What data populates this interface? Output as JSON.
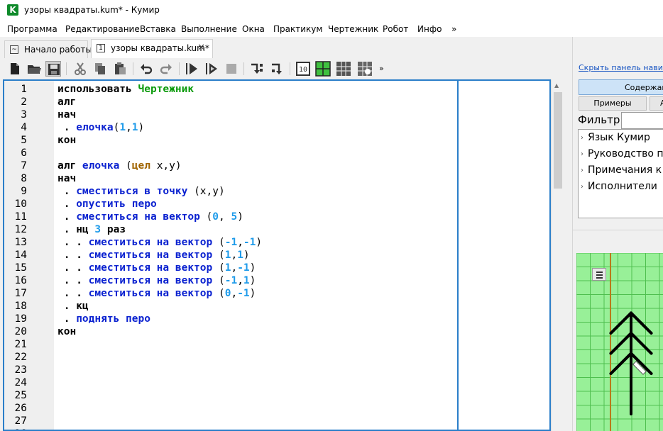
{
  "window": {
    "title": "узоры квадраты.kum* - Кумир",
    "app_icon_letter": "K"
  },
  "menu": [
    "Программа",
    "Редактирование",
    "Вставка",
    "Выполнение",
    "Окна",
    "Практикум",
    "Чертежник",
    "Робот",
    "Инфо",
    "»"
  ],
  "tabs": [
    {
      "label": "Начало работы",
      "icon": "chart-icon"
    },
    {
      "label": "узоры квадраты.kum*",
      "icon": "document-1-icon",
      "active": true
    }
  ],
  "toolbar": {
    "more": "»",
    "icons": [
      "new-file-icon",
      "open-folder-icon",
      "save-icon",
      "cut-icon",
      "copy-icon",
      "paste-icon",
      "undo-icon",
      "redo-icon",
      "run-icon",
      "step-run-icon",
      "stop-icon",
      "step-into-icon",
      "step-out-icon",
      "robot-number-icon",
      "drawer-grid-icon",
      "robot-grid-icon",
      "robot-panel-icon"
    ]
  },
  "editor": {
    "line_count": 28,
    "lines": [
      [
        {
          "t": "использовать ",
          "c": "kw"
        },
        {
          "t": "Чертежник",
          "c": "exe"
        }
      ],
      [
        {
          "t": "алг",
          "c": "kw"
        }
      ],
      [
        {
          "t": "нач",
          "c": "kw"
        }
      ],
      [
        {
          "t": " . ",
          "c": "dot"
        },
        {
          "t": "елочка",
          "c": "act"
        },
        {
          "t": "(",
          "c": "plain"
        },
        {
          "t": "1",
          "c": "num"
        },
        {
          "t": ",",
          "c": "plain"
        },
        {
          "t": "1",
          "c": "num"
        },
        {
          "t": ")",
          "c": "plain"
        }
      ],
      [
        {
          "t": "кон",
          "c": "kw"
        }
      ],
      [],
      [
        {
          "t": "алг ",
          "c": "kw"
        },
        {
          "t": "елочка ",
          "c": "act"
        },
        {
          "t": "(",
          "c": "plain"
        },
        {
          "t": "цел ",
          "c": "type"
        },
        {
          "t": "x,y)",
          "c": "plain"
        }
      ],
      [
        {
          "t": "нач",
          "c": "kw"
        }
      ],
      [
        {
          "t": " . ",
          "c": "dot"
        },
        {
          "t": "сместиться в точку ",
          "c": "act"
        },
        {
          "t": "(x,y)",
          "c": "plain"
        }
      ],
      [
        {
          "t": " . ",
          "c": "dot"
        },
        {
          "t": "опустить перо",
          "c": "act"
        }
      ],
      [
        {
          "t": " . ",
          "c": "dot"
        },
        {
          "t": "сместиться на вектор ",
          "c": "act"
        },
        {
          "t": "(",
          "c": "plain"
        },
        {
          "t": "0",
          "c": "num"
        },
        {
          "t": ", ",
          "c": "plain"
        },
        {
          "t": "5",
          "c": "num"
        },
        {
          "t": ")",
          "c": "plain"
        }
      ],
      [
        {
          "t": " . ",
          "c": "dot"
        },
        {
          "t": "нц ",
          "c": "kw"
        },
        {
          "t": "3",
          "c": "num"
        },
        {
          "t": " раз",
          "c": "kw"
        }
      ],
      [
        {
          "t": " . . ",
          "c": "dot"
        },
        {
          "t": "сместиться на вектор ",
          "c": "act"
        },
        {
          "t": "(",
          "c": "plain"
        },
        {
          "t": "-1",
          "c": "num"
        },
        {
          "t": ",",
          "c": "plain"
        },
        {
          "t": "-1",
          "c": "num"
        },
        {
          "t": ")",
          "c": "plain"
        }
      ],
      [
        {
          "t": " . . ",
          "c": "dot"
        },
        {
          "t": "сместиться на вектор ",
          "c": "act"
        },
        {
          "t": "(",
          "c": "plain"
        },
        {
          "t": "1",
          "c": "num"
        },
        {
          "t": ",",
          "c": "plain"
        },
        {
          "t": "1",
          "c": "num"
        },
        {
          "t": ")",
          "c": "plain"
        }
      ],
      [
        {
          "t": " . . ",
          "c": "dot"
        },
        {
          "t": "сместиться на вектор ",
          "c": "act"
        },
        {
          "t": "(",
          "c": "plain"
        },
        {
          "t": "1",
          "c": "num"
        },
        {
          "t": ",",
          "c": "plain"
        },
        {
          "t": "-1",
          "c": "num"
        },
        {
          "t": ")",
          "c": "plain"
        }
      ],
      [
        {
          "t": " . . ",
          "c": "dot"
        },
        {
          "t": "сместиться на вектор ",
          "c": "act"
        },
        {
          "t": "(",
          "c": "plain"
        },
        {
          "t": "-1",
          "c": "num"
        },
        {
          "t": ",",
          "c": "plain"
        },
        {
          "t": "1",
          "c": "num"
        },
        {
          "t": ")",
          "c": "plain"
        }
      ],
      [
        {
          "t": " . . ",
          "c": "dot"
        },
        {
          "t": "сместиться на вектор ",
          "c": "act"
        },
        {
          "t": "(",
          "c": "plain"
        },
        {
          "t": "0",
          "c": "num"
        },
        {
          "t": ",",
          "c": "plain"
        },
        {
          "t": "-1",
          "c": "num"
        },
        {
          "t": ")",
          "c": "plain"
        }
      ],
      [
        {
          "t": " . ",
          "c": "dot"
        },
        {
          "t": "кц",
          "c": "kw"
        }
      ],
      [
        {
          "t": " . ",
          "c": "dot"
        },
        {
          "t": "поднять перо",
          "c": "act"
        }
      ],
      [
        {
          "t": "кон",
          "c": "kw"
        }
      ]
    ]
  },
  "help_panel": {
    "hide_link": "Скрыть панель навигац",
    "contents_button": "Содержан",
    "examples_button": "Примеры",
    "second_button": "А",
    "filter_label": "Фильтр:",
    "filter_value": "",
    "tree_items": [
      "Язык Кумир",
      "Руководство по",
      "Примечания к",
      "Исполнители"
    ]
  },
  "drawing": {
    "background_color": "#98f098",
    "grid_color": "#4fbf4f",
    "axis_color": "#b87a1a",
    "pen_color": "#000000"
  }
}
